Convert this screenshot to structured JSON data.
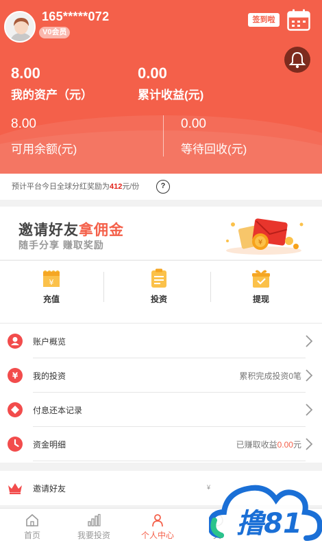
{
  "user": {
    "phone": "165*****072",
    "vip_label": "V0会员"
  },
  "header": {
    "signin_label": "签到啦",
    "total_assets_value": "8.00",
    "total_assets_label": "我的资产（元）",
    "cumulative_income_value": "0.00",
    "cumulative_income_label": "累计收益(元)",
    "available_balance_value": "8.00",
    "available_balance_label": "可用余额(元)",
    "pending_return_value": "0.00",
    "pending_return_label": "等待回收(元)"
  },
  "notice": {
    "prefix": "预计平台今日全球分红奖励为",
    "amount": "412",
    "suffix": "元/份",
    "help_symbol": "?"
  },
  "banner": {
    "title_part1": "邀请好友",
    "title_part2": "拿佣金",
    "subtitle": "随手分享 赚取奖励"
  },
  "actions": [
    {
      "label": "充值",
      "icon": "wallet-icon"
    },
    {
      "label": "投资",
      "icon": "clipboard-icon"
    },
    {
      "label": "提现",
      "icon": "gift-box-icon"
    }
  ],
  "menu": [
    {
      "label": "账户概览",
      "icon": "user-icon",
      "right": ""
    },
    {
      "label": "我的投资",
      "icon": "yen-icon",
      "right": "累积完成投资0笔"
    },
    {
      "label": "付息还本记录",
      "icon": "diamond-icon",
      "right": ""
    },
    {
      "label": "资金明细",
      "icon": "clock-icon",
      "right_prefix": "已赚取收益",
      "right_value": "0.00",
      "right_suffix": "元"
    }
  ],
  "invite": {
    "label": "邀请好友",
    "icon": "crown-icon",
    "tick": "¥"
  },
  "tabbar": [
    {
      "label": "首页",
      "icon": "home-icon",
      "active": false
    },
    {
      "label": "我要投资",
      "icon": "bar-chart-icon",
      "active": false
    },
    {
      "label": "个人中心",
      "icon": "person-icon",
      "active": true
    },
    {
      "label": "关",
      "icon": "info-icon",
      "active": false
    }
  ],
  "watermark": {
    "text": "撸81"
  },
  "colors": {
    "primary": "#f4604a",
    "icon_red": "#f24c4c",
    "bell_bg": "#7d2b1e",
    "watermark_blue": "#1a6fd6",
    "watermark_green": "#2bc38b"
  }
}
